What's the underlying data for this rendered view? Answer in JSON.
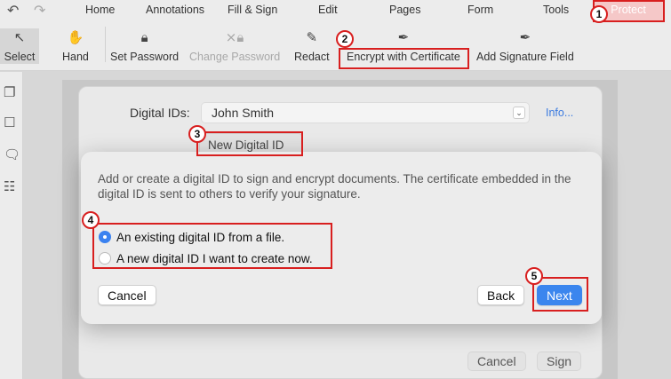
{
  "menu": {
    "undo_icon": "undo-icon",
    "redo_icon": "redo-icon",
    "items": [
      "Home",
      "Annotations",
      "Fill & Sign",
      "Edit",
      "Pages",
      "Form",
      "Tools",
      "Protect"
    ]
  },
  "toolbar": {
    "tools": [
      {
        "label": "Select",
        "icon": "cursor-arrow-icon"
      },
      {
        "label": "Hand",
        "icon": "hand-icon"
      },
      {
        "label": "Set Password",
        "icon": "lock-icon"
      },
      {
        "label": "Change Password",
        "icon": "change-lock-icon"
      },
      {
        "label": "Redact",
        "icon": "redact-pen-icon"
      },
      {
        "label": "Encrypt with Certificate",
        "icon": "certificate-pen-icon"
      },
      {
        "label": "Add Signature Field",
        "icon": "signature-pen-icon"
      }
    ]
  },
  "siderail": [
    "thumbnails-icon",
    "bookmark-icon",
    "comments-icon",
    "form-list-icon"
  ],
  "background_dialog": {
    "digital_ids_label": "Digital IDs:",
    "selected_id": "John Smith",
    "info_link": "Info...",
    "new_id_button": "New Digital ID",
    "cancel": "Cancel",
    "sign": "Sign"
  },
  "dialog": {
    "description": "Add or create a digital ID to sign and encrypt documents. The certificate embedded in the digital ID is sent to others to verify your signature.",
    "options": [
      {
        "label": "An existing digital ID from a file.",
        "checked": true
      },
      {
        "label": "A new digital ID I want to create now.",
        "checked": false
      }
    ],
    "cancel": "Cancel",
    "back": "Back",
    "next": "Next"
  },
  "annotations": {
    "color": "#d81f1f",
    "markers": [
      "1",
      "2",
      "3",
      "4",
      "5"
    ]
  }
}
